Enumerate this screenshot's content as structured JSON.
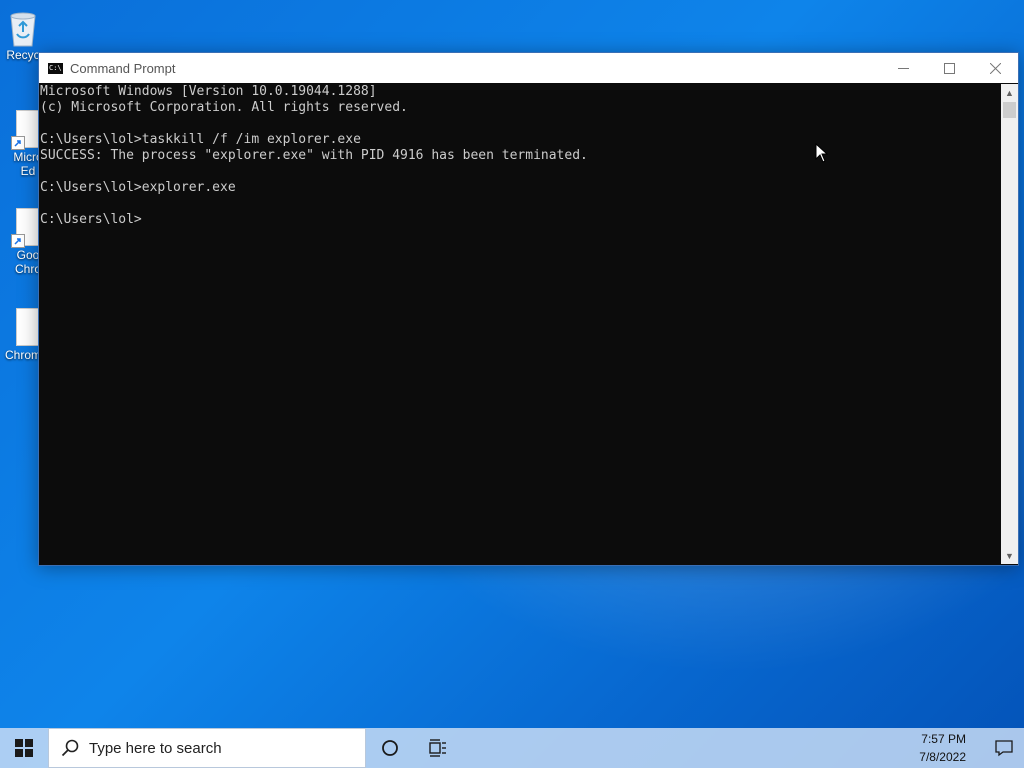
{
  "desktop": {
    "icons": [
      {
        "label": "Recyc"
      },
      {
        "label": "Micro\nEd"
      },
      {
        "label": "Goo\nChro"
      },
      {
        "label": "Chrom"
      }
    ]
  },
  "window": {
    "title": "Command Prompt",
    "icon_text": "C:\\",
    "console_lines": [
      "Microsoft Windows [Version 10.0.19044.1288]",
      "(c) Microsoft Corporation. All rights reserved.",
      "",
      "C:\\Users\\lol>taskkill /f /im explorer.exe",
      "SUCCESS: The process \"explorer.exe\" with PID 4916 has been terminated.",
      "",
      "C:\\Users\\lol>explorer.exe",
      "",
      "C:\\Users\\lol>"
    ]
  },
  "taskbar": {
    "search_placeholder": "Type here to search",
    "time": "7:57 PM",
    "date": "7/8/2022"
  },
  "colors": {
    "console_bg": "#0c0c0c",
    "console_text": "#cccccc",
    "taskbar_bg": "#c8dcf5"
  }
}
